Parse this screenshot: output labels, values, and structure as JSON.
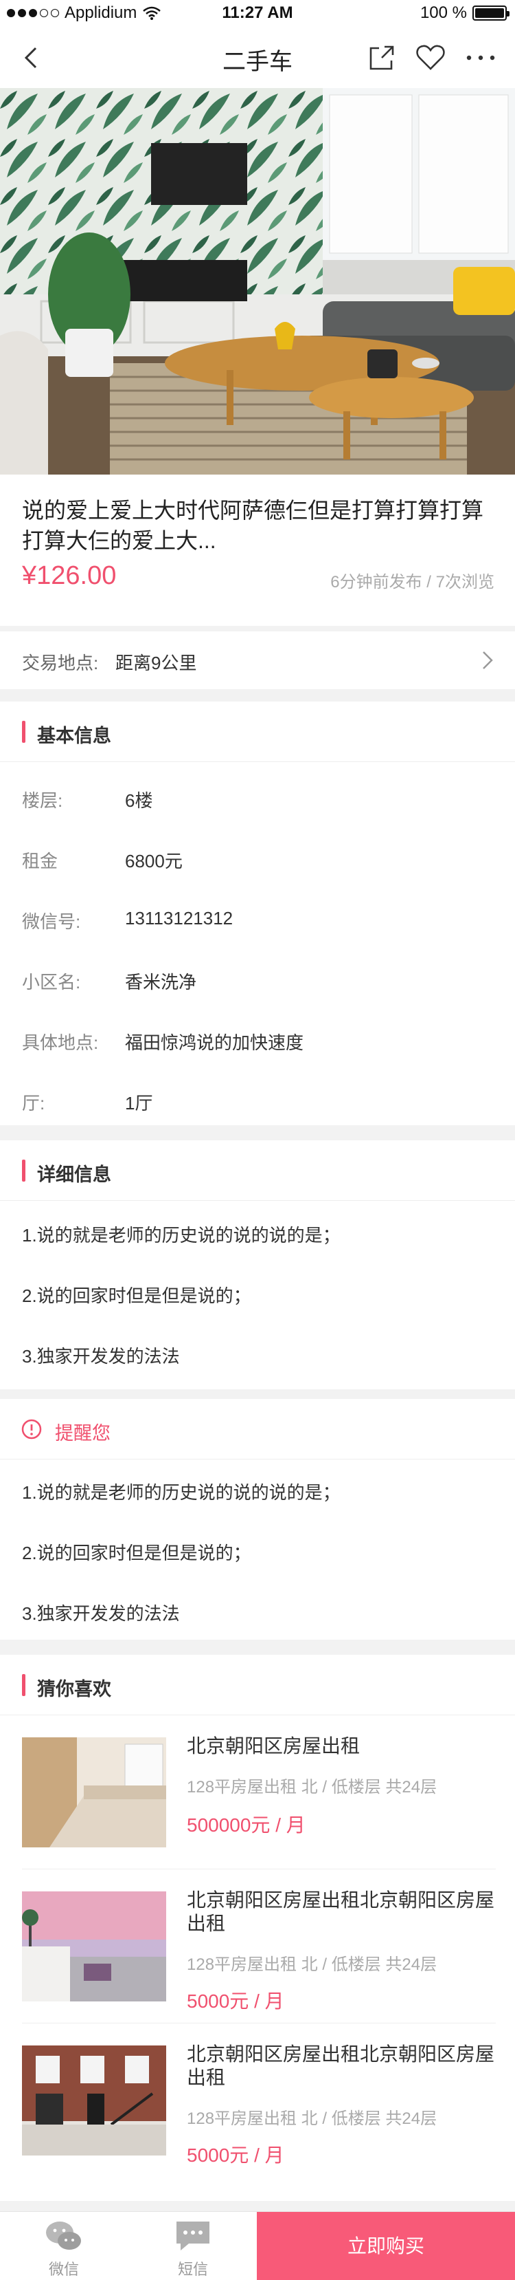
{
  "status_bar": {
    "carrier": "Applidium",
    "time": "11:27 AM",
    "battery": "100 %",
    "battery_level": 1.0
  },
  "nav": {
    "title": "二手车"
  },
  "product": {
    "title": "说的爱上爱上大时代阿萨德仨但是打算打算打算打算大仨的爱上大...",
    "price": "¥126.00",
    "meta": "6分钟前发布  /  7次浏览"
  },
  "location": {
    "label": "交易地点:",
    "value": "距离9公里"
  },
  "basic_info": {
    "title": "基本信息",
    "rows": [
      {
        "k": "楼层:",
        "v": "6楼"
      },
      {
        "k": "租金",
        "v": "6800元"
      },
      {
        "k": "微信号:",
        "v": "13113121312"
      },
      {
        "k": "小区名:",
        "v": "香米洗净"
      },
      {
        "k": "具体地点:",
        "v": "福田惊鸿说的加快速度"
      },
      {
        "k": "厅:",
        "v": "1厅"
      }
    ]
  },
  "detail_info": {
    "title": "详细信息",
    "items": [
      "1.说的就是老师的历史说的说的说的是；",
      "2.说的回家时但是但是说的；",
      "3.独家开发发的法法"
    ]
  },
  "reminder": {
    "title": "提醒您",
    "items": [
      "1.说的就是老师的历史说的说的说的是；",
      "2.说的回家时但是但是说的；",
      "3.独家开发发的法法"
    ]
  },
  "recommend": {
    "title": "猜你喜欢",
    "items": [
      {
        "title": "北京朝阳区房屋出租",
        "sub": "128平房屋出租  北 / 低楼层  共24层",
        "price": "500000元 / 月"
      },
      {
        "title": "北京朝阳区房屋出租北京朝阳区房屋出租",
        "sub": "128平房屋出租  北 / 低楼层  共24层",
        "price": "5000元 / 月"
      },
      {
        "title": "北京朝阳区房屋出租北京朝阳区房屋出租",
        "sub": "128平房屋出租  北 / 低楼层  共24层",
        "price": "5000元 / 月"
      }
    ]
  },
  "tab_bar": {
    "wechat": "微信",
    "sms": "短信",
    "buy": "立即购买"
  },
  "colors": {
    "accent": "#f0506e",
    "buy_button": "#f85a78"
  }
}
